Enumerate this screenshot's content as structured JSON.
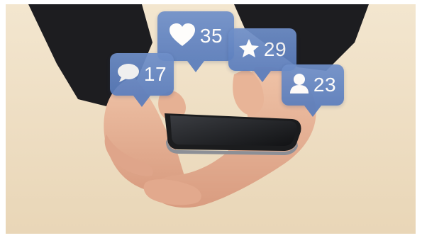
{
  "notifications": {
    "likes": {
      "icon": "heart-icon",
      "count": "35"
    },
    "comments": {
      "icon": "comment-icon",
      "count": "17"
    },
    "stars": {
      "icon": "star-icon",
      "count": "29"
    },
    "followers": {
      "icon": "user-icon",
      "count": "23"
    }
  },
  "colors": {
    "bubble": "#5a7dbd",
    "background": "#efe2c8",
    "sleeve": "#1c1c1e",
    "skin": "#e9b79a",
    "phone": "#2a2a2c"
  }
}
